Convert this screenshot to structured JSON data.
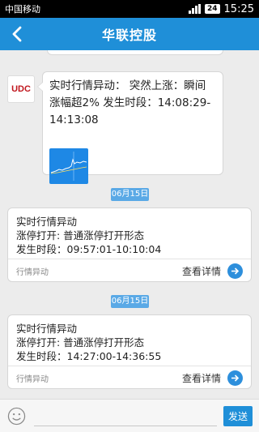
{
  "statusbar": {
    "carrier": "中国移动",
    "battery": "24",
    "time": "15:25"
  },
  "titlebar": {
    "title": "华联控股"
  },
  "message": {
    "avatar_text": "UDC",
    "text": "实时行情异动： 突然上涨：瞬间涨幅超2% 发生时段：14:08:29-14:13:08"
  },
  "cards": [
    {
      "date": "06月15日",
      "line1": "实时行情异动",
      "line2": "涨停打开: 普通涨停打开形态",
      "line3": "发生时段：09:57:01-10:10:04",
      "tag": "行情异动",
      "link": "查看详情"
    },
    {
      "date": "06月15日",
      "line1": "实时行情异动",
      "line2": "涨停打开: 普通涨停打开形态",
      "line3": "发生时段：14:27:00-14:36:55",
      "tag": "行情异动",
      "link": "查看详情"
    }
  ],
  "inputbar": {
    "placeholder": "",
    "send_label": "发送"
  },
  "colors": {
    "accent": "#1f8fd8",
    "badge": "#5aa9e6"
  }
}
